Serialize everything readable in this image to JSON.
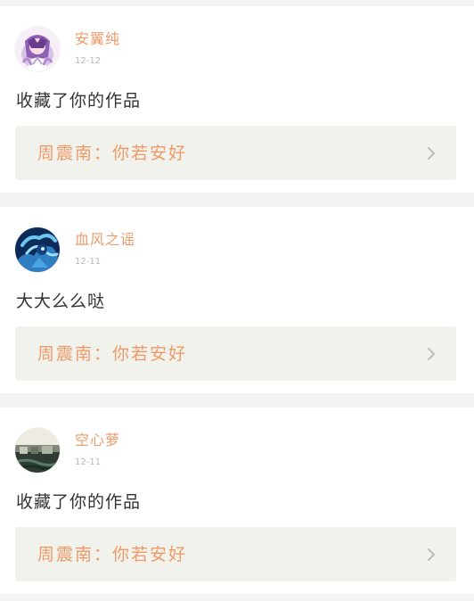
{
  "items": [
    {
      "user_name": "安翼纯",
      "date": "12-12",
      "message": "收藏了你的作品",
      "work_author": "周震南",
      "separator": "：",
      "work_title": "你若安好",
      "avatar_icon": "anime-girl-avatar"
    },
    {
      "user_name": "血风之谣",
      "date": "12-11",
      "message": "大大么么哒",
      "work_author": "周震南",
      "separator": "：",
      "work_title": "你若安好",
      "avatar_icon": "blue-dragon-avatar"
    },
    {
      "user_name": "空心萝",
      "date": "12-11",
      "message": "收藏了你的作品",
      "work_author": "周震南",
      "separator": "：",
      "work_title": "你若安好",
      "avatar_icon": "landscape-photo-avatar"
    }
  ],
  "colors": {
    "accent": "#ee9a68",
    "card_background": "#ffffff",
    "page_background": "#f3f3f3",
    "work_box_background": "#f2f2ec",
    "message_text": "#333333",
    "date_text": "#b9b9b9"
  }
}
